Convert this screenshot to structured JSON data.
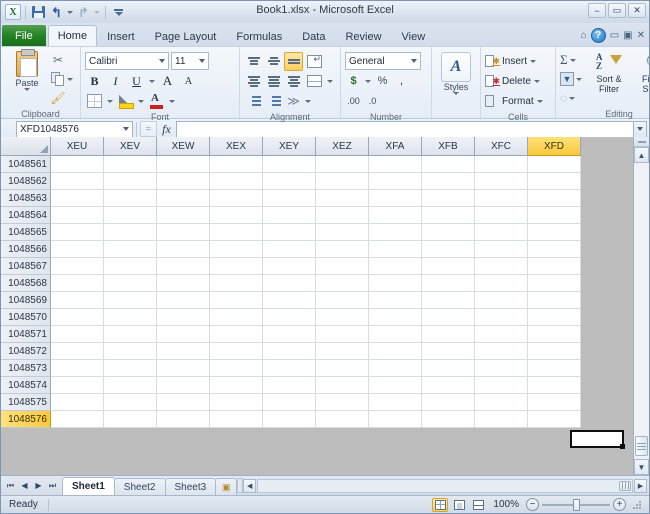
{
  "window": {
    "title": "Book1.xlsx - Microsoft Excel",
    "minimize": "−",
    "maximize": "▭",
    "close": "✕"
  },
  "quick_access": {
    "logo": "X",
    "save": "save-icon",
    "undo": "↰",
    "redo": "↱",
    "customize": "customize-qat-icon"
  },
  "ribbon": {
    "file_tab": "File",
    "tabs": [
      {
        "label": "Home",
        "active": true
      },
      {
        "label": "Insert",
        "active": false
      },
      {
        "label": "Page Layout",
        "active": false
      },
      {
        "label": "Formulas",
        "active": false
      },
      {
        "label": "Data",
        "active": false
      },
      {
        "label": "Review",
        "active": false
      },
      {
        "label": "View",
        "active": false
      }
    ],
    "help": "?",
    "minimize_ribbon": "▭",
    "restore_window": "▣",
    "close_window": "✕",
    "collapse_ribbon": "⌂",
    "groups": {
      "clipboard": {
        "label": "Clipboard",
        "paste": "Paste",
        "cut": "✂",
        "copy": "copy-icon",
        "format_painter": "🖌",
        "dialog_launcher": "◢"
      },
      "font": {
        "label": "Font",
        "font_name": "Calibri",
        "font_size": "11",
        "bold": "B",
        "italic": "I",
        "underline": "U",
        "grow_font": "A",
        "shrink_font": "A",
        "borders": "borders-icon",
        "fill_color": "fill-color-icon",
        "font_color": "font-color-icon",
        "dialog_launcher": "◢"
      },
      "alignment": {
        "label": "Alignment",
        "top_align": "top-align-icon",
        "middle_align": "middle-align-icon",
        "bottom_align": "bottom-align-icon",
        "wrap_text": "wrap-text-icon",
        "align_left": "align-left-icon",
        "align_center": "align-center-icon",
        "align_right": "align-right-icon",
        "merge_center": "merge-center-icon",
        "decrease_indent": "decrease-indent-icon",
        "increase_indent": "increase-indent-icon",
        "orientation": "orientation-icon",
        "dialog_launcher": "◢"
      },
      "number": {
        "label": "Number",
        "format": "General",
        "accounting": "$",
        "percent": "%",
        "comma": ",",
        "increase_decimal": ".00",
        "decrease_decimal": ".0",
        "dialog_launcher": "◢"
      },
      "styles": {
        "label": "Styles",
        "button": "Styles",
        "glyph": "A"
      },
      "cells": {
        "label": "Cells",
        "insert": "Insert",
        "delete": "Delete",
        "format": "Format"
      },
      "editing": {
        "label": "Editing",
        "autosum": "Σ",
        "fill": "▼",
        "clear": "◌",
        "sort_filter_line1": "Sort &",
        "sort_filter_line2": "Filter",
        "find_select_line1": "Find &",
        "find_select_line2": "Select"
      }
    }
  },
  "formula_bar": {
    "name_box": "XFD1048576",
    "cancel_accept": "=",
    "fx": "fx",
    "formula_value": "",
    "expand": "▾"
  },
  "grid": {
    "columns": [
      "XEU",
      "XEV",
      "XEW",
      "XEX",
      "XEY",
      "XEZ",
      "XFA",
      "XFB",
      "XFC",
      "XFD"
    ],
    "selected_column": "XFD",
    "rows": [
      "1048561",
      "1048562",
      "1048563",
      "1048564",
      "1048565",
      "1048566",
      "1048567",
      "1048568",
      "1048569",
      "1048570",
      "1048571",
      "1048572",
      "1048573",
      "1048574",
      "1048575",
      "1048576"
    ],
    "selected_row": "1048576",
    "active_cell": "XFD1048576",
    "cell_values": []
  },
  "sheet_tabs": {
    "first": "⏮",
    "prev": "◀",
    "next": "▶",
    "last": "⏭",
    "tabs": [
      {
        "label": "Sheet1",
        "active": true
      },
      {
        "label": "Sheet2",
        "active": false
      },
      {
        "label": "Sheet3",
        "active": false
      }
    ],
    "insert_sheet": "insert-worksheet-icon"
  },
  "status_bar": {
    "status": "Ready",
    "view_normal": "normal-view-icon",
    "view_page_layout": "page-layout-view-icon",
    "view_page_break": "page-break-view-icon",
    "zoom": "100%",
    "zoom_out": "−",
    "zoom_in": "+"
  },
  "colors": {
    "file_tab_green": "#238323",
    "selection_gold": "#f9c93e",
    "ribbon_bg": "#f4f7fb",
    "grid_line": "#d6dce4"
  }
}
